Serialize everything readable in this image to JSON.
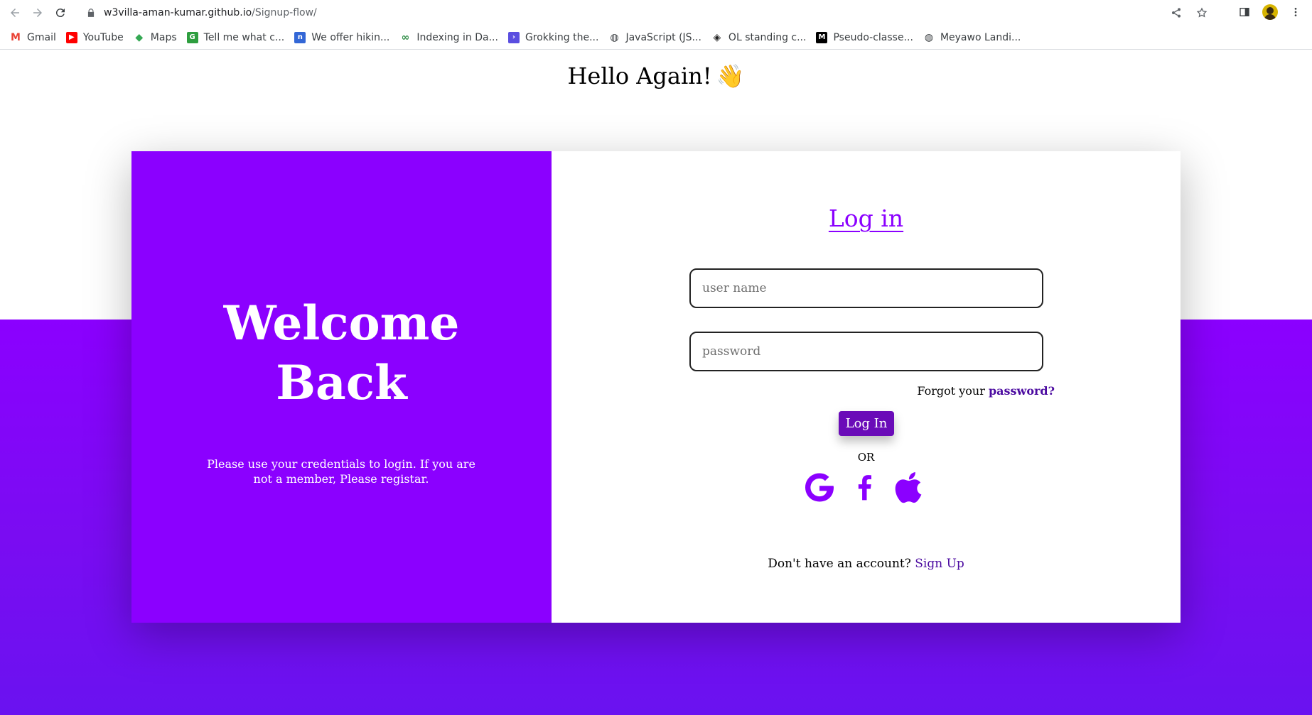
{
  "browser": {
    "url_host": "w3villa-aman-kumar.github.io",
    "url_path": "/Signup-flow/",
    "bookmarks": [
      {
        "label": "Gmail",
        "icon": "gmail-icon",
        "color": "#ea4335"
      },
      {
        "label": "YouTube",
        "icon": "youtube-icon",
        "color": "#ff0000"
      },
      {
        "label": "Maps",
        "icon": "maps-icon",
        "color": "#34a853"
      },
      {
        "label": "Tell me what c...",
        "icon": "grammarly-icon",
        "color": "#2e9e3f"
      },
      {
        "label": "We offer hikin...",
        "icon": "n-icon",
        "color": "#3367d6"
      },
      {
        "label": "Indexing in Da...",
        "icon": "geeksforgeeks-icon",
        "color": "#2f8d46"
      },
      {
        "label": "Grokking the...",
        "icon": "terminal-icon",
        "color": "#5a4ee0"
      },
      {
        "label": "JavaScript (JS...",
        "icon": "globe-icon",
        "color": "#3c4043"
      },
      {
        "label": "OL standing c...",
        "icon": "codepen-icon",
        "color": "#222222"
      },
      {
        "label": "Pseudo-classe...",
        "icon": "mdn-icon",
        "color": "#000000"
      },
      {
        "label": "Meyawo Landi...",
        "icon": "globe-icon",
        "color": "#3c4043"
      }
    ]
  },
  "page": {
    "greeting": "Hello Again!",
    "greeting_emoji": "👋",
    "welcome_line1": "Welcome",
    "welcome_line2": "Back",
    "note": "Please use your credentials to login. If you are not a member, Please registar.",
    "login_title": "Log in",
    "username_placeholder": "user name",
    "password_placeholder": "password",
    "forgot_prefix": "Forgot your",
    "forgot_link": "password?",
    "login_button": "Log In",
    "or_text": "OR",
    "signup_prefix": "Don't have an account?",
    "signup_link": "Sign Up",
    "social": [
      "google-icon",
      "facebook-icon",
      "apple-icon"
    ],
    "accent_color": "#8b00ff"
  }
}
